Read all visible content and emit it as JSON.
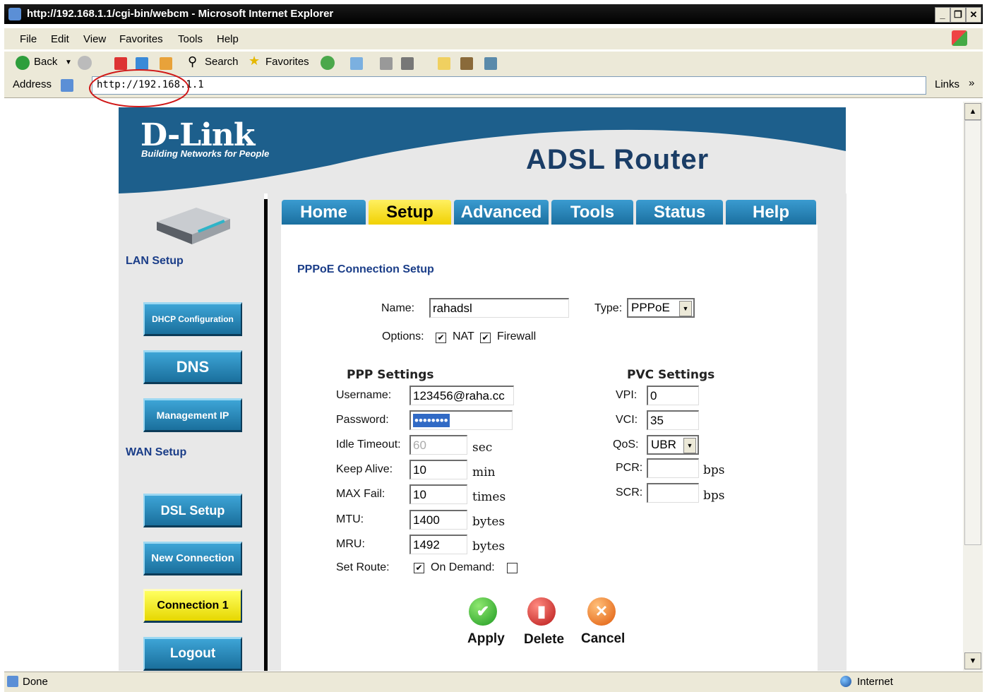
{
  "window": {
    "title": "http://192.168.1.1/cgi-bin/webcm - Microsoft Internet Explorer"
  },
  "menu": [
    "File",
    "Edit",
    "View",
    "Favorites",
    "Tools",
    "Help"
  ],
  "toolbar": {
    "back": "Back",
    "search": "Search",
    "favorites": "Favorites"
  },
  "address": {
    "label": "Address",
    "value": "http://192.168.1.1",
    "links": "Links"
  },
  "status": {
    "text": "Done",
    "zone": "Internet"
  },
  "brand": {
    "logo": "D-Link",
    "tagline": "Building Networks for People",
    "product": "ADSL Router"
  },
  "tabs": [
    "Home",
    "Setup",
    "Advanced",
    "Tools",
    "Status",
    "Help"
  ],
  "active_tab": "Setup",
  "sidebar": {
    "lan_title": "LAN Setup",
    "lan_items": [
      "DHCP Configuration",
      "DNS",
      "Management IP"
    ],
    "wan_title": "WAN Setup",
    "wan_items": [
      "DSL Setup",
      "New Connection",
      "Connection 1",
      "Logout"
    ],
    "active_item": "Connection 1"
  },
  "form": {
    "heading": "PPPoE Connection Setup",
    "name_label": "Name:",
    "name_value": "rahadsl",
    "type_label": "Type:",
    "type_value": "PPPoE",
    "options_label": "Options:",
    "nat_label": "NAT",
    "nat_checked": true,
    "firewall_label": "Firewall",
    "firewall_checked": true,
    "ppp": {
      "title": "PPP Settings",
      "username_label": "Username:",
      "username_value": "123456@raha.cc",
      "password_label": "Password:",
      "password_value": "••••••••",
      "idle_label": "Idle Timeout:",
      "idle_value": "60",
      "idle_unit": "sec",
      "keepalive_label": "Keep Alive:",
      "keepalive_value": "10",
      "keepalive_unit": "min",
      "maxfail_label": "MAX Fail:",
      "maxfail_value": "10",
      "maxfail_unit": "times",
      "mtu_label": "MTU:",
      "mtu_value": "1400",
      "mtu_unit": "bytes",
      "mru_label": "MRU:",
      "mru_value": "1492",
      "mru_unit": "bytes",
      "setroute_label": "Set Route:",
      "setroute_checked": true,
      "ondemand_label": "On Demand:",
      "ondemand_checked": false
    },
    "pvc": {
      "title": "PVC Settings",
      "vpi_label": "VPI:",
      "vpi_value": "0",
      "vci_label": "VCI:",
      "vci_value": "35",
      "qos_label": "QoS:",
      "qos_value": "UBR",
      "pcr_label": "PCR:",
      "pcr_value": "",
      "pcr_unit": "bps",
      "scr_label": "SCR:",
      "scr_value": "",
      "scr_unit": "bps"
    }
  },
  "actions": {
    "apply": "Apply",
    "delete": "Delete",
    "cancel": "Cancel"
  },
  "colors": {
    "header_blue": "#1d5f8c",
    "tab_blue": "#2a86bd",
    "active_yellow": "#f2d900",
    "section_blue": "#1a3d88"
  }
}
